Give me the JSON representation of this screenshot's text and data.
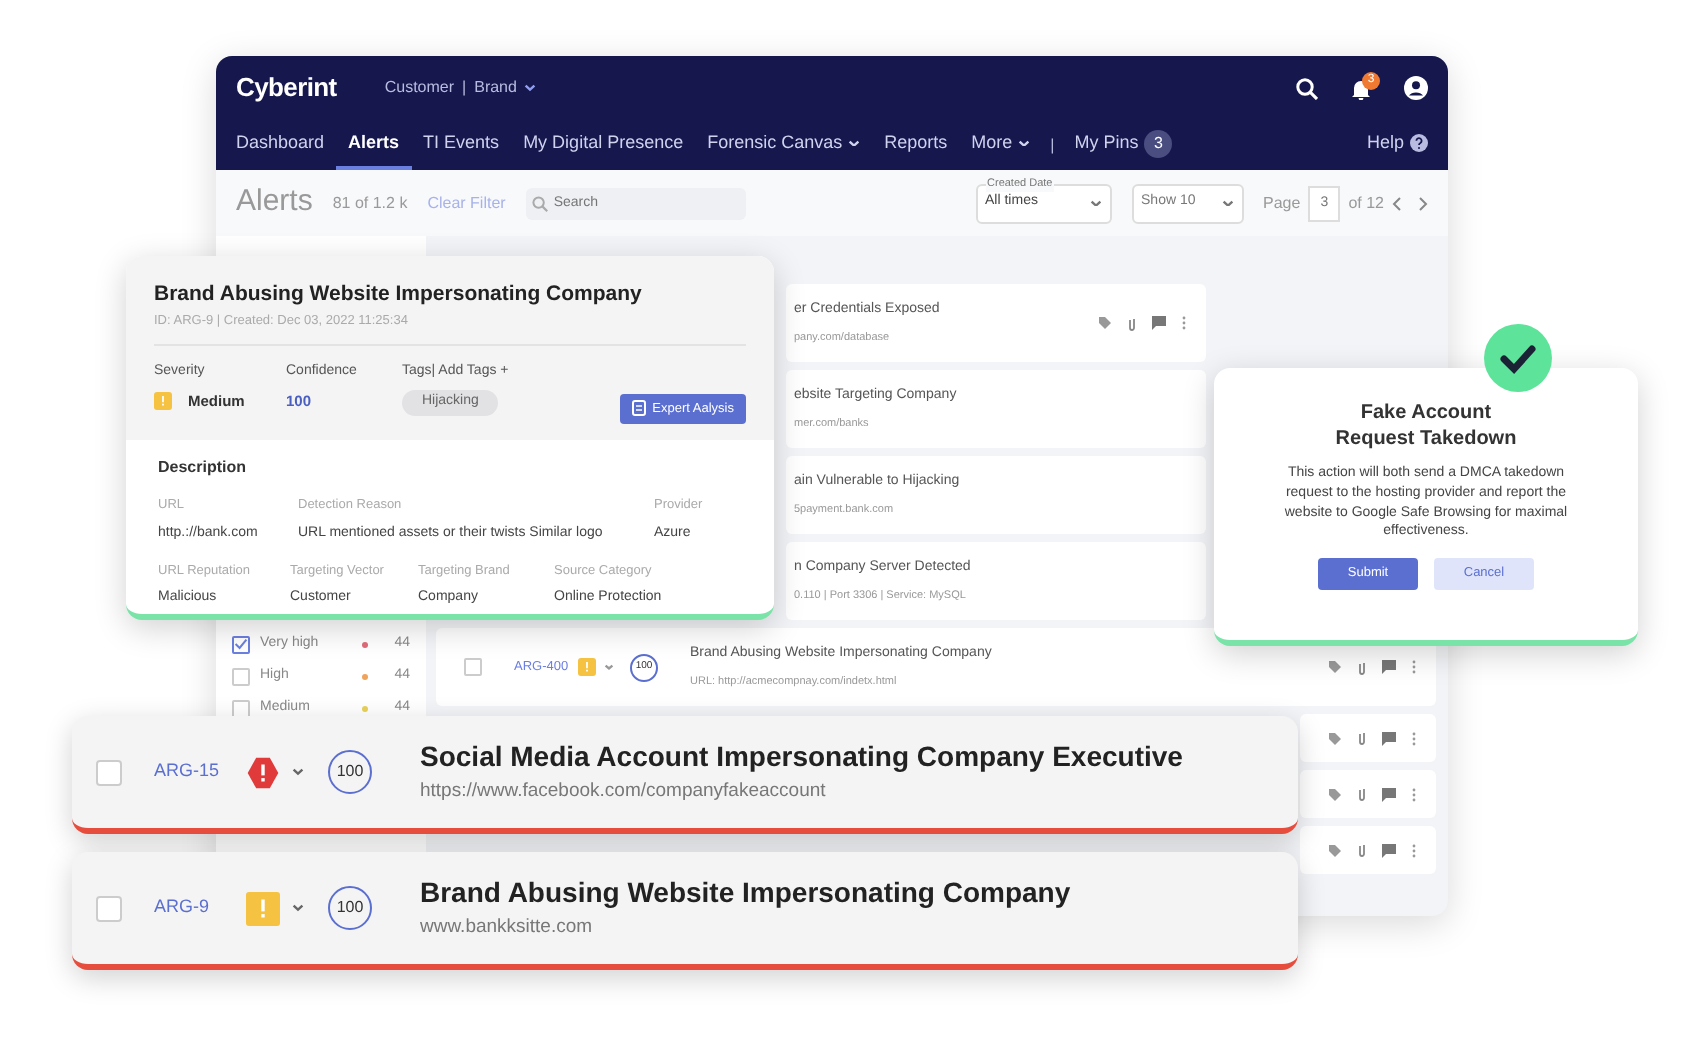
{
  "app": {
    "logo": "Cyberint",
    "context": {
      "customer": "Customer",
      "separator": "|",
      "brand": "Brand"
    },
    "notifications": "3",
    "nav": [
      {
        "label": "Dashboard",
        "selected": false,
        "dropdown": false
      },
      {
        "label": "Alerts",
        "selected": true,
        "dropdown": false
      },
      {
        "label": "TI Events",
        "selected": false,
        "dropdown": false
      },
      {
        "label": "My Digital Presence",
        "selected": false,
        "dropdown": false
      },
      {
        "label": "Forensic Canvas",
        "selected": false,
        "dropdown": true
      },
      {
        "label": "Reports",
        "selected": false,
        "dropdown": false
      },
      {
        "label": "More",
        "selected": false,
        "dropdown": true
      }
    ],
    "pins_separator": "|",
    "pins": {
      "label": "My Pins",
      "count": "3"
    },
    "help": "Help"
  },
  "toolbar": {
    "title": "Alerts",
    "count": "81 of 1.2 k",
    "clear": "Clear Filter",
    "search": {
      "placeholder": "Search"
    },
    "date": {
      "label": "Created Date",
      "value": "All times"
    },
    "show": "Show 10",
    "page_label": "Page",
    "page": "3",
    "page_total": "of 12"
  },
  "filters": [
    {
      "label": "Very high",
      "checked": true,
      "color": "#e06b7a",
      "count": "44"
    },
    {
      "label": "High",
      "checked": false,
      "color": "#f0a35a",
      "count": "44"
    },
    {
      "label": "Medium",
      "checked": false,
      "color": "#e8d25a",
      "count": "44"
    }
  ],
  "alerts": [
    {
      "kind": "covered",
      "title": "er Credentials Exposed",
      "url": "pany.com/database",
      "icons": true
    },
    {
      "kind": "covered",
      "title": "ebsite Targeting Company",
      "url": "mer.com/banks",
      "icons": false
    },
    {
      "kind": "covered",
      "title": "ain Vulnerable to Hijacking",
      "url": "5payment.bank.com",
      "icons": false
    },
    {
      "kind": "covered",
      "title": "n Company Server Detected",
      "url": "0.110 | Port 3306 | Service: MySQL",
      "icons": false
    },
    {
      "kind": "full",
      "id": "ARG-400",
      "checked": false,
      "severity": {
        "kind": "medium"
      },
      "confidence": "100",
      "title": "Brand Abusing Website Impersonating Company",
      "url": "URL: http://acmecompnay.com/indetx.html",
      "icons": true
    },
    {
      "kind": "hidden",
      "icons": true
    },
    {
      "kind": "hidden",
      "icons": true
    },
    {
      "kind": "hidden",
      "icons": true
    }
  ],
  "detail": {
    "title": "Brand Abusing Website Impersonating Company",
    "meta": "ID: ARG-9 | Created: Dec 03, 2022 11:25:34",
    "severity": {
      "label": "Severity",
      "value": "Medium",
      "kind": "medium"
    },
    "confidence": {
      "label": "Confidence",
      "value": "100"
    },
    "tags": {
      "label": "Tags| Add Tags +",
      "items": [
        "Hijacking"
      ]
    },
    "action": "Expert Aalysis",
    "section": "Description",
    "fields": [
      [
        {
          "label": "URL",
          "value": "http.://bank.com"
        },
        {
          "label": "Detection Reason",
          "value": "URL mentioned assets or their twists Similar logo"
        },
        {
          "label": "Provider",
          "value": "Azure"
        }
      ],
      [
        {
          "label": "URL Reputation",
          "value": "Malicious"
        },
        {
          "label": "Targeting Vector",
          "value": "Customer"
        },
        {
          "label": "Targeting Brand",
          "value": "Company"
        },
        {
          "label": "Source Category",
          "value": "Online Protection"
        }
      ]
    ]
  },
  "dialog": {
    "title": "Fake Account\nRequest Takedown",
    "text": "This action will both send a DMCA takedown request to the hosting provider and report the website to Google Safe Browsing for maximal effectiveness.",
    "submit": "Submit",
    "cancel": "Cancel"
  },
  "featured": [
    {
      "id": "ARG-15",
      "checked": false,
      "severity": {
        "kind": "high"
      },
      "confidence": "100",
      "title": "Social Media Account Impersonating Company Executive",
      "url": "https://www.facebook.com/companyfakeaccount"
    },
    {
      "id": "ARG-9",
      "checked": false,
      "severity": {
        "kind": "medium"
      },
      "confidence": "100",
      "title": "Brand Abusing Website Impersonating Company",
      "url": "www.bankksitte.com"
    }
  ]
}
